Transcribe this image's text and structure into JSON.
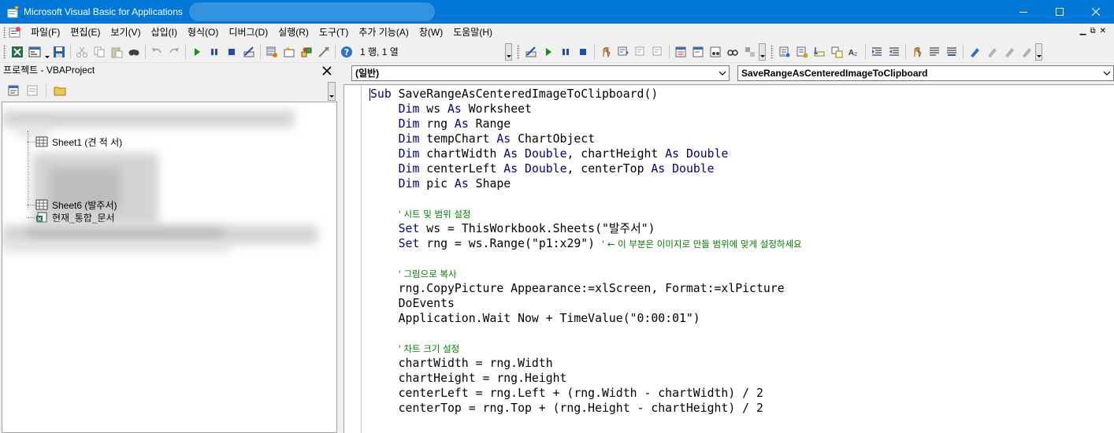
{
  "window": {
    "title": "Microsoft Visual Basic for Applications"
  },
  "menubar": {
    "items": [
      "파일(F)",
      "편집(E)",
      "보기(V)",
      "삽입(I)",
      "형식(O)",
      "디버그(D)",
      "실행(R)",
      "도구(T)",
      "추가 기능(A)",
      "창(W)",
      "도움말(H)"
    ]
  },
  "toolbar": {
    "position_status": "1 행, 1 열"
  },
  "project": {
    "title": "프로젝트 - VBAProject",
    "tree": [
      {
        "label": "Sheet1 (견   적   서)",
        "icon": "worksheet-icon"
      },
      {
        "label": "Sheet6 (발주서)",
        "icon": "worksheet-icon"
      },
      {
        "label": "현재_통합_문서",
        "icon": "workbook-icon"
      }
    ]
  },
  "code": {
    "object_combo": "(일반)",
    "procedure_combo": "SaveRangeAsCenteredImageToClipboard",
    "lines": [
      [
        {
          "t": "Sub",
          "c": "kw"
        },
        {
          "t": " SaveRangeAsCenteredImageToClipboard()"
        }
      ],
      [
        {
          "t": "    "
        },
        {
          "t": "Dim",
          "c": "kw"
        },
        {
          "t": " ws "
        },
        {
          "t": "As",
          "c": "kw"
        },
        {
          "t": " Worksheet"
        }
      ],
      [
        {
          "t": "    "
        },
        {
          "t": "Dim",
          "c": "kw"
        },
        {
          "t": " rng "
        },
        {
          "t": "As",
          "c": "kw"
        },
        {
          "t": " Range"
        }
      ],
      [
        {
          "t": "    "
        },
        {
          "t": "Dim",
          "c": "kw"
        },
        {
          "t": " tempChart "
        },
        {
          "t": "As",
          "c": "kw"
        },
        {
          "t": " ChartObject"
        }
      ],
      [
        {
          "t": "    "
        },
        {
          "t": "Dim",
          "c": "kw"
        },
        {
          "t": " chartWidth "
        },
        {
          "t": "As",
          "c": "kw"
        },
        {
          "t": " "
        },
        {
          "t": "Double",
          "c": "kw"
        },
        {
          "t": ", chartHeight "
        },
        {
          "t": "As",
          "c": "kw"
        },
        {
          "t": " "
        },
        {
          "t": "Double",
          "c": "kw"
        }
      ],
      [
        {
          "t": "    "
        },
        {
          "t": "Dim",
          "c": "kw"
        },
        {
          "t": " centerLeft "
        },
        {
          "t": "As",
          "c": "kw"
        },
        {
          "t": " "
        },
        {
          "t": "Double",
          "c": "kw"
        },
        {
          "t": ", centerTop "
        },
        {
          "t": "As",
          "c": "kw"
        },
        {
          "t": " "
        },
        {
          "t": "Double",
          "c": "kw"
        }
      ],
      [
        {
          "t": "    "
        },
        {
          "t": "Dim",
          "c": "kw"
        },
        {
          "t": " pic "
        },
        {
          "t": "As",
          "c": "kw"
        },
        {
          "t": " Shape"
        }
      ],
      [],
      [
        {
          "t": "    "
        },
        {
          "t": "' 시트 및 범위 설정",
          "c": "cm"
        }
      ],
      [
        {
          "t": "    "
        },
        {
          "t": "Set",
          "c": "kw"
        },
        {
          "t": " ws = ThisWorkbook.Sheets(\"발주서\")"
        }
      ],
      [
        {
          "t": "    "
        },
        {
          "t": "Set",
          "c": "kw"
        },
        {
          "t": " rng = ws.Range(\"p1:x29\") "
        },
        {
          "t": "' ← 이 부분은 이미지로 만들 범위에 맞게 설정하세요",
          "c": "cm"
        }
      ],
      [],
      [
        {
          "t": "    "
        },
        {
          "t": "' 그림으로 복사",
          "c": "cm"
        }
      ],
      [
        {
          "t": "    rng.CopyPicture Appearance:=xlScreen, Format:=xlPicture"
        }
      ],
      [
        {
          "t": "    DoEvents"
        }
      ],
      [
        {
          "t": "    Application.Wait Now + TimeValue(\"0:00:01\")"
        }
      ],
      [],
      [
        {
          "t": "    "
        },
        {
          "t": "' 차트 크기 설정",
          "c": "cm"
        }
      ],
      [
        {
          "t": "    chartWidth = rng.Width"
        }
      ],
      [
        {
          "t": "    chartHeight = rng.Height"
        }
      ],
      [
        {
          "t": "    centerLeft = rng.Left + (rng.Width - chartWidth) / 2"
        }
      ],
      [
        {
          "t": "    centerTop = rng.Top + (rng.Height - chartHeight) / 2"
        }
      ]
    ]
  },
  "colors": {
    "titlebar": "#0078d7",
    "keyword": "#00008b",
    "comment": "#008000"
  }
}
